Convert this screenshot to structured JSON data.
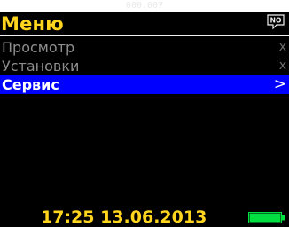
{
  "caption": "000.007",
  "header": {
    "title": "Меню",
    "icon": "no-sound-icon",
    "icon_text": "NO"
  },
  "menu": {
    "items": [
      {
        "label": "Просмотр",
        "mark": "x",
        "selected": false
      },
      {
        "label": "Установки",
        "mark": "x",
        "selected": false
      },
      {
        "label": "Сервис",
        "mark": ">",
        "selected": true
      }
    ]
  },
  "status": {
    "datetime": "17:25 13.06.2013",
    "battery_icon": "battery-icon",
    "battery_level": 1.0
  },
  "colors": {
    "background": "#000000",
    "title": "#ffd51e",
    "selection": "#0000ff",
    "item_text": "#8d8d8d",
    "battery": "#00e040"
  }
}
